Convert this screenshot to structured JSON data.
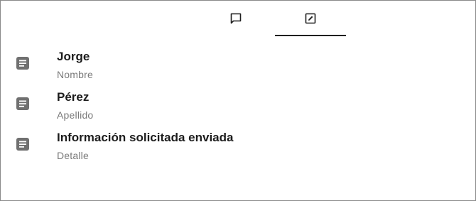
{
  "tabs": [
    {
      "icon": "chat-bubble-icon",
      "active": false
    },
    {
      "icon": "edit-square-icon",
      "active": true
    }
  ],
  "fields": [
    {
      "icon": "document-icon",
      "value": "Jorge",
      "label": "Nombre"
    },
    {
      "icon": "document-icon",
      "value": "Pérez",
      "label": "Apellido"
    },
    {
      "icon": "document-icon",
      "value": "Información solicitada enviada",
      "label": "Detalle"
    }
  ],
  "colors": {
    "icon": "#707070",
    "primary_text": "#1c1c1c",
    "secondary_text": "#7a7a7a",
    "active_indicator": "#1f1f1f",
    "border": "#8a8a8a"
  }
}
